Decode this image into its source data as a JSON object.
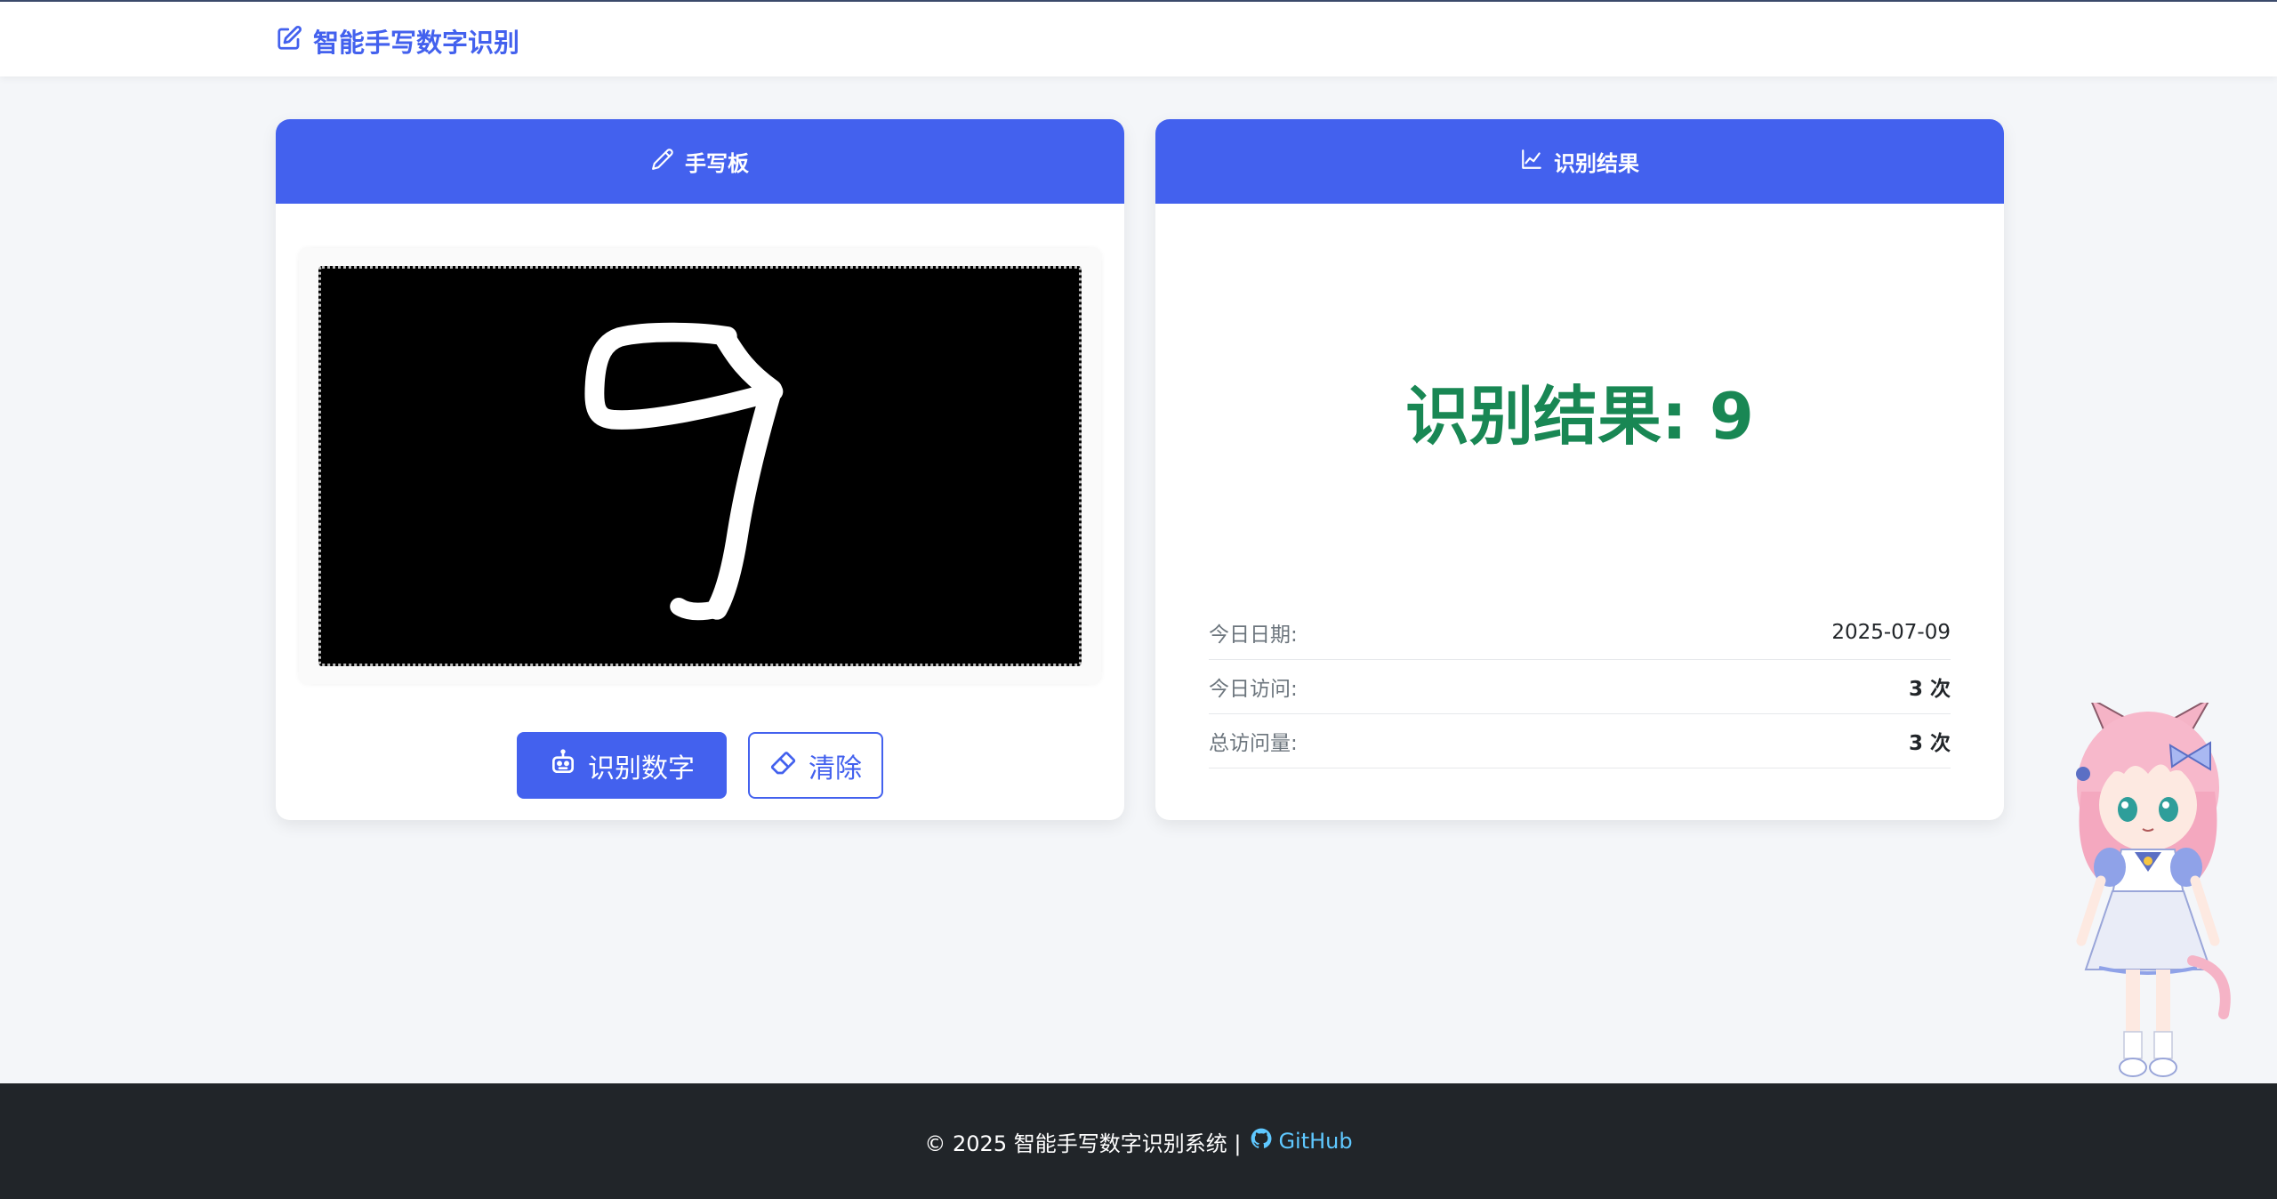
{
  "navbar": {
    "brand_icon": "pencil-square-icon",
    "brand_text": "智能手写数字识别"
  },
  "drawing_card": {
    "header_icon": "pencil-icon",
    "header_title": "手写板",
    "recognize_icon": "robot-icon",
    "recognize_label": "识别数字",
    "clear_icon": "eraser-icon",
    "clear_label": "清除"
  },
  "result_card": {
    "header_icon": "graph-up-icon",
    "header_title": "识别结果",
    "result_text": "识别结果: 9",
    "stats": [
      {
        "label": "今日日期:",
        "value": "2025-07-09"
      },
      {
        "label": "今日访问:",
        "value": "3 次"
      },
      {
        "label": "总访问量:",
        "value": "3 次"
      }
    ]
  },
  "footer": {
    "copyright": "© 2025 智能手写数字识别系统 |",
    "github_icon": "github-icon",
    "github_label": "GitHub"
  },
  "colors": {
    "primary": "#4361ee",
    "success": "#198754",
    "footer_bg": "#212529",
    "link": "#5fc8ff"
  }
}
